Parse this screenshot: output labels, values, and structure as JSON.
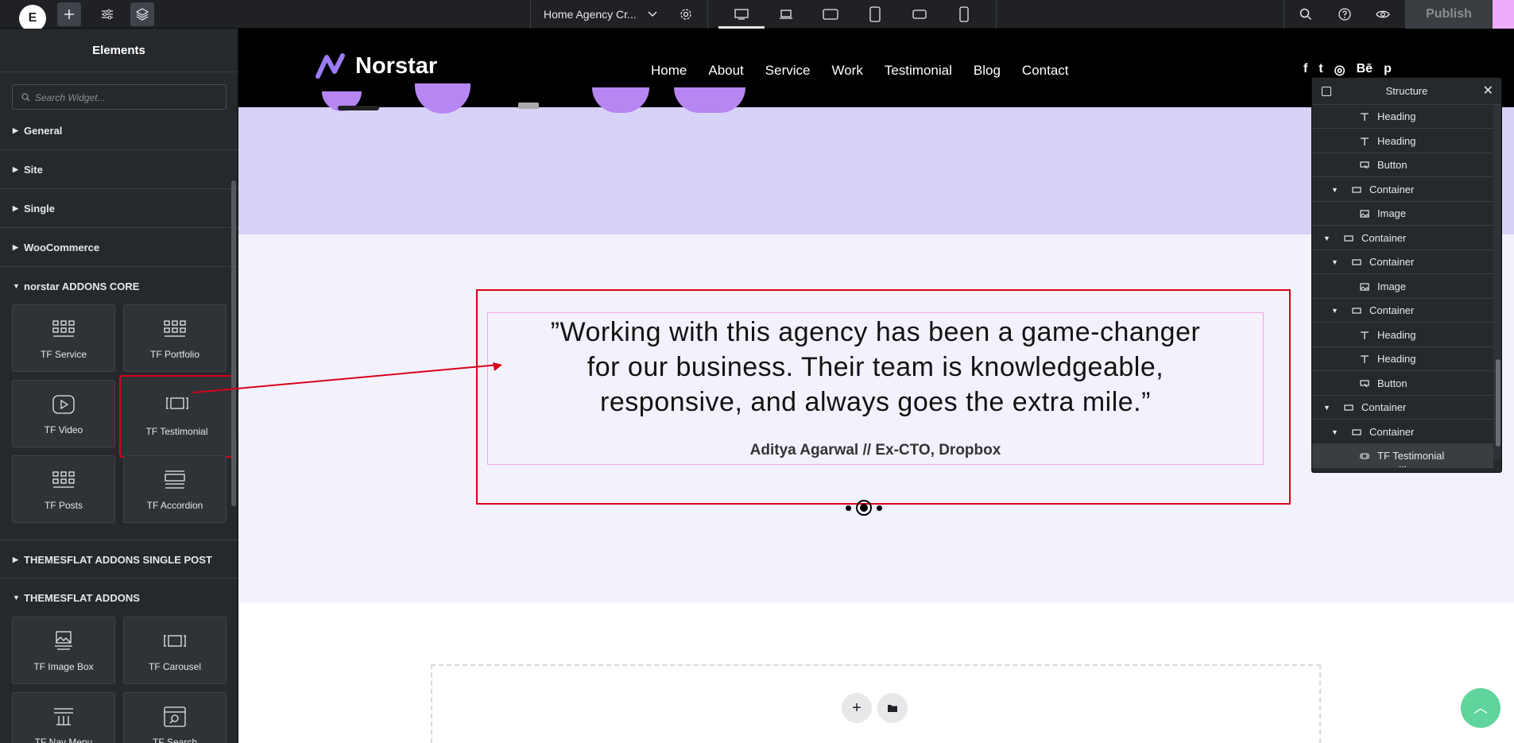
{
  "topbar": {
    "logo": "E",
    "document_title": "Home Agency Cr...",
    "publish_label": "Publish"
  },
  "sidebar": {
    "title": "Elements",
    "search_placeholder": "Search Widget...",
    "categories": [
      {
        "label": "General",
        "expanded": false
      },
      {
        "label": "Site",
        "expanded": false
      },
      {
        "label": "Single",
        "expanded": false
      },
      {
        "label": "WooCommerce",
        "expanded": false
      },
      {
        "label": "norstar ADDONS CORE",
        "expanded": true
      },
      {
        "label": "THEMESFLAT ADDONS SINGLE POST",
        "expanded": false
      },
      {
        "label": "THEMESFLAT ADDONS",
        "expanded": true
      }
    ],
    "core_widgets": [
      {
        "label": "TF Service",
        "icon": "grid-icon"
      },
      {
        "label": "TF Portfolio",
        "icon": "grid-icon"
      },
      {
        "label": "TF Video",
        "icon": "video-icon"
      },
      {
        "label": "TF Testimonial",
        "icon": "carousel-icon"
      },
      {
        "label": "TF Posts",
        "icon": "grid-icon"
      },
      {
        "label": "TF Accordion",
        "icon": "accordion-icon"
      }
    ],
    "addon_widgets": [
      {
        "label": "TF Image Box",
        "icon": "image-box-icon"
      },
      {
        "label": "TF Carousel",
        "icon": "carousel-icon"
      },
      {
        "label": "TF Nav Menu",
        "icon": "nav-menu-icon"
      },
      {
        "label": "TF Search",
        "icon": "search-box-icon"
      }
    ]
  },
  "site": {
    "brand": "Norstar",
    "nav": [
      "Home",
      "About",
      "Service",
      "Work",
      "Testimonial",
      "Blog",
      "Contact"
    ],
    "socials": [
      "f",
      "t",
      "◎",
      "Bē",
      "p"
    ]
  },
  "testimonial": {
    "quote_line1": "”Working with this agency has been a game-changer",
    "quote_line2": "for our business. Their team is knowledgeable,",
    "quote_line3": "responsive, and always goes the extra mile.”",
    "author": "Aditya Agarwal // Ex-CTO, Dropbox"
  },
  "structure": {
    "title": "Structure",
    "rows": [
      {
        "label": "Heading",
        "icon": "heading-icon",
        "level": 2,
        "arrow": false
      },
      {
        "label": "Heading",
        "icon": "heading-icon",
        "level": 2,
        "arrow": false
      },
      {
        "label": "Button",
        "icon": "button-icon",
        "level": 2,
        "arrow": false
      },
      {
        "label": "Container",
        "icon": "container-icon",
        "level": 1,
        "arrow": true
      },
      {
        "label": "Image",
        "icon": "image-icon",
        "level": 2,
        "arrow": false
      },
      {
        "label": "Container",
        "icon": "container-icon",
        "level": 0,
        "arrow": true
      },
      {
        "label": "Container",
        "icon": "container-icon",
        "level": 1,
        "arrow": true
      },
      {
        "label": "Image",
        "icon": "image-icon",
        "level": 2,
        "arrow": false
      },
      {
        "label": "Container",
        "icon": "container-icon",
        "level": 1,
        "arrow": true
      },
      {
        "label": "Heading",
        "icon": "heading-icon",
        "level": 2,
        "arrow": false
      },
      {
        "label": "Heading",
        "icon": "heading-icon",
        "level": 2,
        "arrow": false
      },
      {
        "label": "Button",
        "icon": "button-icon",
        "level": 2,
        "arrow": false
      },
      {
        "label": "Container",
        "icon": "container-icon",
        "level": 0,
        "arrow": true
      },
      {
        "label": "Container",
        "icon": "container-icon",
        "level": 1,
        "arrow": true
      },
      {
        "label": "TF Testimonial",
        "icon": "carousel-icon",
        "level": 2,
        "arrow": false,
        "selected": true
      }
    ],
    "more": "..."
  },
  "colors": {
    "editor_dark": "#26292c",
    "topbar": "#1f2124",
    "highlight_red": "#d9001b",
    "hero_band": "#d7d3f8",
    "testimonial_bg": "#f3f1fc",
    "scroll_top": "#5fd49c",
    "brand_accent": "#9b7cf5"
  }
}
